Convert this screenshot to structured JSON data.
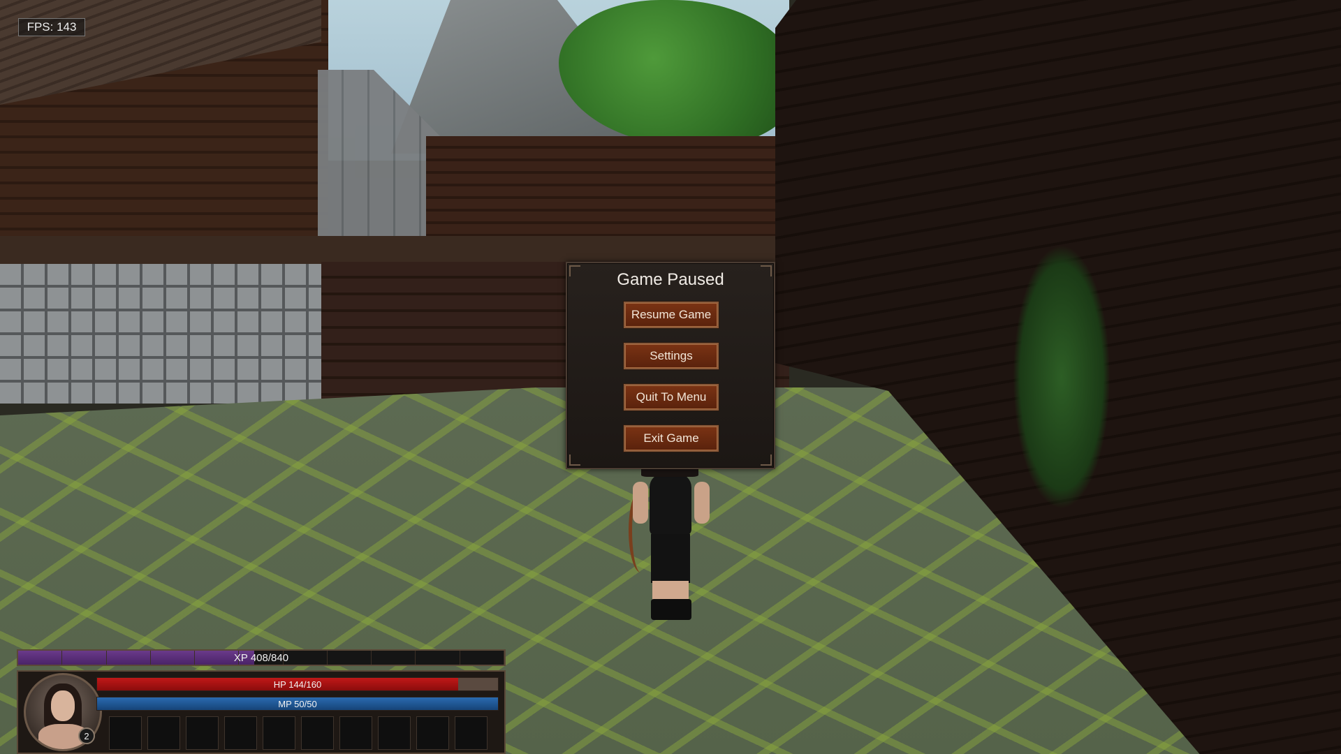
{
  "hud": {
    "fps_label": "FPS: 143",
    "xp": {
      "label": "XP 408/840",
      "current": 408,
      "max": 840,
      "segments": 11,
      "color": "#5a2d7a"
    },
    "hp": {
      "label": "HP 144/160",
      "current": 144,
      "max": 160,
      "color": "#b01414"
    },
    "mp": {
      "label": "MP 50/50",
      "current": 50,
      "max": 50,
      "color": "#2060a8"
    },
    "level": "2",
    "skill_slots": 10
  },
  "pause_menu": {
    "title": "Game Paused",
    "buttons": {
      "resume": "Resume Game",
      "settings": "Settings",
      "quit": "Quit To Menu",
      "exit": "Exit Game"
    }
  },
  "icons": {
    "portrait": "character-portrait"
  }
}
